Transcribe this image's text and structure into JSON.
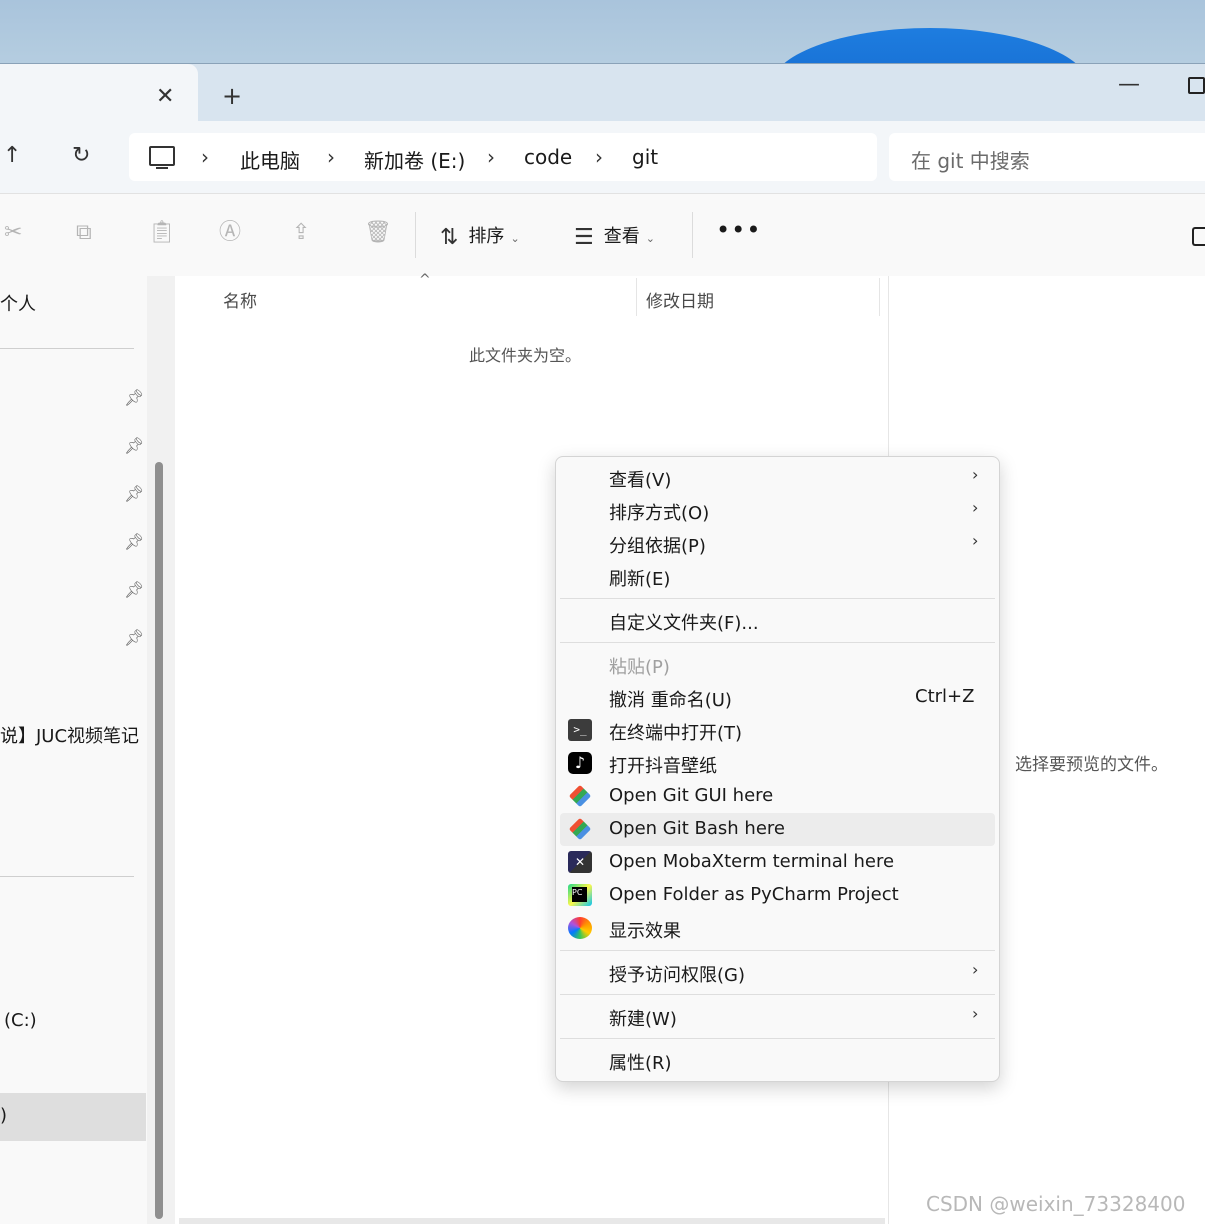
{
  "tab": {
    "close_glyph": "✕",
    "new_tab_glyph": "+"
  },
  "window": {
    "minimize_glyph": "—"
  },
  "nav": {
    "up_glyph": "↑",
    "refresh_glyph": "↻",
    "breadcrumbs": [
      "此电脑",
      "新加卷 (E:)",
      "code",
      "git"
    ],
    "separator": "›",
    "search_placeholder": "在 git 中搜索"
  },
  "toolbar": {
    "sort_label": "排序",
    "view_label": "查看",
    "more_glyph": "•••"
  },
  "sidebar": {
    "top_item": "个人",
    "folder_item": "说】JUC视频笔记",
    "drive_c": "(C:)",
    "selected_item": ")"
  },
  "content": {
    "col_name": "名称",
    "col_date": "修改日期",
    "empty_message": "此文件夹为空。"
  },
  "preview": {
    "message": "选择要预览的文件。",
    "watermark": "CSDN @weixin_73328400"
  },
  "context_menu": {
    "items": [
      {
        "label": "查看(V)",
        "arrow": "›"
      },
      {
        "label": "排序方式(O)",
        "arrow": "›"
      },
      {
        "label": "分组依据(P)",
        "arrow": "›"
      },
      {
        "label": "刷新(E)"
      },
      {
        "label": "自定义文件夹(F)..."
      },
      {
        "label": "粘贴(P)",
        "disabled": true
      },
      {
        "label": "撤消 重命名(U)",
        "shortcut": "Ctrl+Z"
      },
      {
        "label": "在终端中打开(T)",
        "icon": "terminal-icon"
      },
      {
        "label": "打开抖音壁纸",
        "icon": "tiktok-icon"
      },
      {
        "label": "Open Git GUI here",
        "icon": "git-gui-icon"
      },
      {
        "label": "Open Git Bash here",
        "icon": "git-bash-icon",
        "hover": true
      },
      {
        "label": "Open MobaXterm terminal here",
        "icon": "mobaxterm-icon"
      },
      {
        "label": "Open Folder as PyCharm Project",
        "icon": "pycharm-icon"
      },
      {
        "label": "显示效果",
        "icon": "color-effects-icon"
      },
      {
        "label": "授予访问权限(G)",
        "arrow": "›"
      },
      {
        "label": "新建(W)",
        "arrow": "›"
      },
      {
        "label": "属性(R)"
      }
    ]
  },
  "colors": {
    "accent": "#0f5fc4",
    "menu_hover": "#ececec"
  }
}
